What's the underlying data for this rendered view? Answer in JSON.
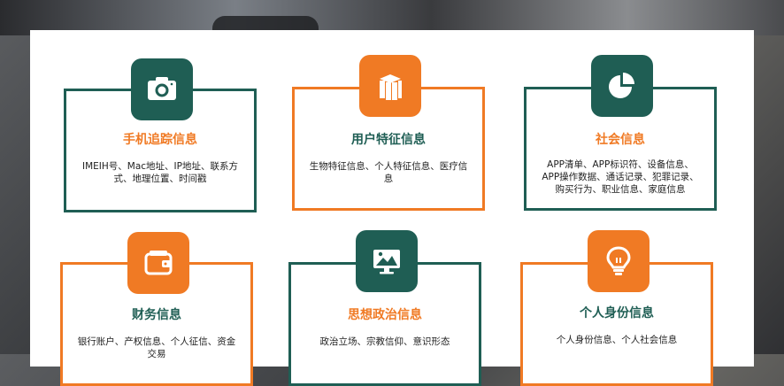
{
  "cards": [
    {
      "title": "手机追踪信息",
      "desc": "IMEIH号、Mac地址、IP地址、联系方式、地理位置、时间戳",
      "icon": "camera-icon"
    },
    {
      "title": "用户特征信息",
      "desc": "生物特征信息、个人特征信息、医疗信息",
      "icon": "books-icon"
    },
    {
      "title": "社会信息",
      "desc": "APP清单、APP标识符、设备信息、APP操作数据、通话记录、犯罪记录、购买行为、职业信息、家庭信息",
      "icon": "pie-chart-icon"
    },
    {
      "title": "财务信息",
      "desc": "银行账户、产权信息、个人征信、资金交易",
      "icon": "wallet-icon"
    },
    {
      "title": "思想政治信息",
      "desc": "政治立场、宗教信仰、意识形态",
      "icon": "monitor-icon"
    },
    {
      "title": "个人身份信息",
      "desc": "个人身份信息、个人社会信息",
      "icon": "lightbulb-icon"
    }
  ]
}
